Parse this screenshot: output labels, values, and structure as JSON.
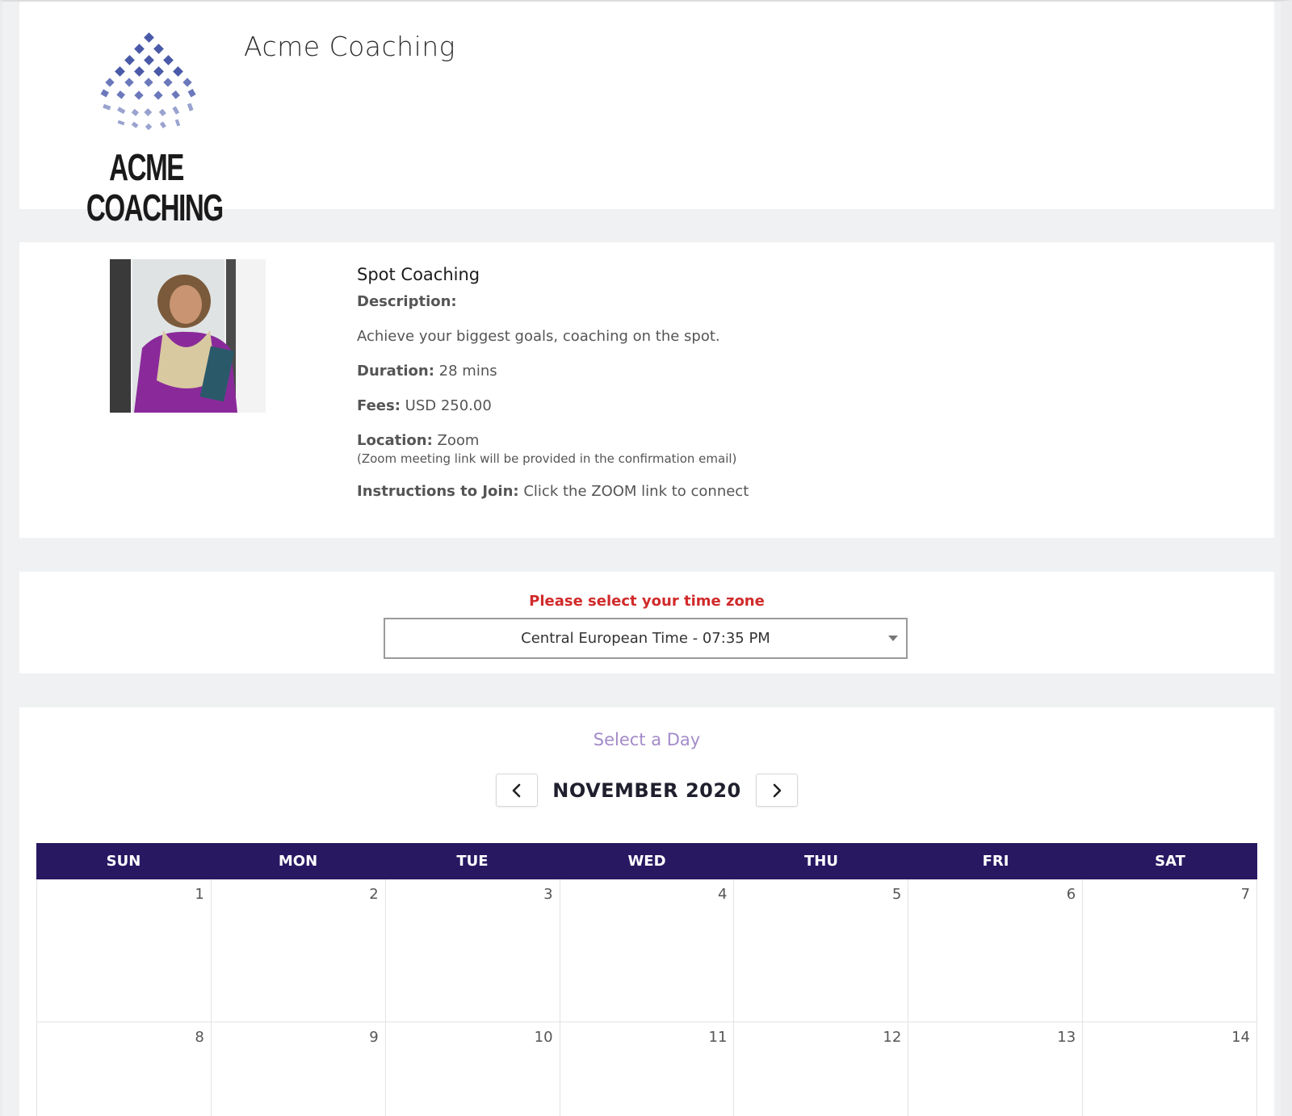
{
  "header": {
    "logo_text": "ACME COACHING",
    "company_name": "Acme Coaching"
  },
  "service": {
    "title": "Spot Coaching",
    "description_label": "Description:",
    "description": "Achieve your biggest goals, coaching on the spot.",
    "duration_label": "Duration:",
    "duration": "28 mins",
    "fees_label": "Fees:",
    "fees": "USD 250.00",
    "location_label": "Location:",
    "location": "Zoom",
    "location_note": "(Zoom meeting link will be provided in the confirmation email)",
    "instructions_label": "Instructions to Join:",
    "instructions": "Click the ZOOM link to connect"
  },
  "timezone": {
    "prompt": "Please select your time zone",
    "selected": "Central European Time - 07:35 PM"
  },
  "calendar": {
    "caption": "Select a Day",
    "month": "NOVEMBER 2020",
    "weekdays": [
      "SUN",
      "MON",
      "TUE",
      "WED",
      "THU",
      "FRI",
      "SAT"
    ],
    "weeks": [
      [
        "1",
        "2",
        "3",
        "4",
        "5",
        "6",
        "7"
      ],
      [
        "8",
        "9",
        "10",
        "11",
        "12",
        "13",
        "14"
      ]
    ]
  },
  "colors": {
    "accent_purple": "#281862",
    "caption_purple": "#a38bc8",
    "warning_red": "#d12a2a",
    "logo_blue": "#4a5aa8"
  },
  "icons": {
    "prev": "chevron-left-icon",
    "next": "chevron-right-icon",
    "dropdown": "caret-down-icon"
  }
}
